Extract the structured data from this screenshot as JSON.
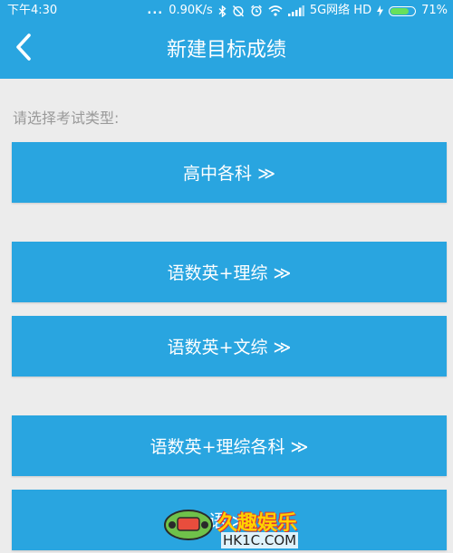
{
  "status_bar": {
    "time": "下午4:30",
    "dots": "...",
    "speed": "0.90K/s",
    "network": "5G网络 HD",
    "battery_percent": "71%",
    "battery_level": 0.71,
    "icons": [
      "bluetooth-icon",
      "alarm-off-icon",
      "alarm-icon",
      "wifi-icon",
      "signal-icon",
      "charging-icon",
      "battery-icon"
    ]
  },
  "header": {
    "back_icon": "chevron-left-icon",
    "title": "新建目标成绩"
  },
  "prompt": "请选择考试类型:",
  "options": [
    {
      "label": "高中各科 ≫"
    },
    {
      "label": "语数英+理综 ≫"
    },
    {
      "label": "语数英+文综 ≫"
    },
    {
      "label": "语数英+理综各科 ≫"
    },
    {
      "label": "语 ≫"
    }
  ],
  "watermark": {
    "text": "久趣娱乐",
    "domain": "HK1C.COM"
  },
  "colors": {
    "primary": "#29a5e0",
    "background": "#ececec",
    "prompt_text": "#9a9a9a"
  }
}
